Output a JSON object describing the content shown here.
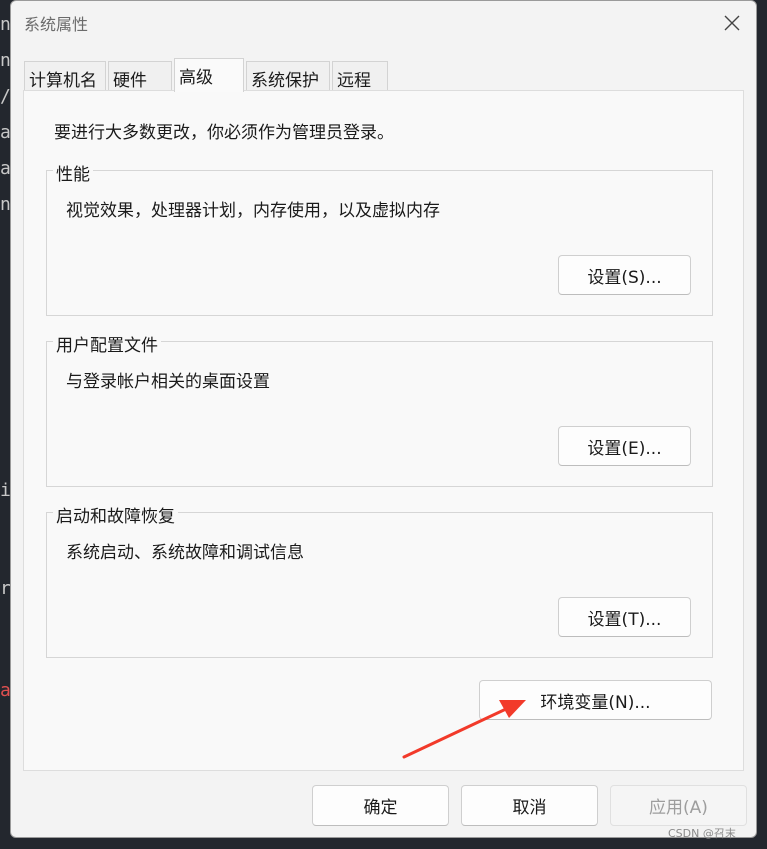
{
  "window": {
    "title": "系统属性"
  },
  "tabs": [
    {
      "label": "计算机名"
    },
    {
      "label": "硬件"
    },
    {
      "label": "高级"
    },
    {
      "label": "系统保护"
    },
    {
      "label": "远程"
    }
  ],
  "active_tab": "高级",
  "panel": {
    "admin_note": "要进行大多数更改，你必须作为管理员登录。",
    "performance": {
      "title": "性能",
      "description": "视觉效果，处理器计划，内存使用，以及虚拟内存",
      "button": "设置(S)..."
    },
    "user_profiles": {
      "title": "用户配置文件",
      "description": "与登录帐户相关的桌面设置",
      "button": "设置(E)..."
    },
    "startup_recovery": {
      "title": "启动和故障恢复",
      "description": "系统启动、系统故障和调试信息",
      "button": "设置(T)..."
    },
    "env_button": "环境变量(N)..."
  },
  "footer": {
    "ok": "确定",
    "cancel": "取消",
    "apply": "应用(A)"
  },
  "annotation": {
    "color": "#f23a2a"
  },
  "watermark": "CSDN @召末"
}
